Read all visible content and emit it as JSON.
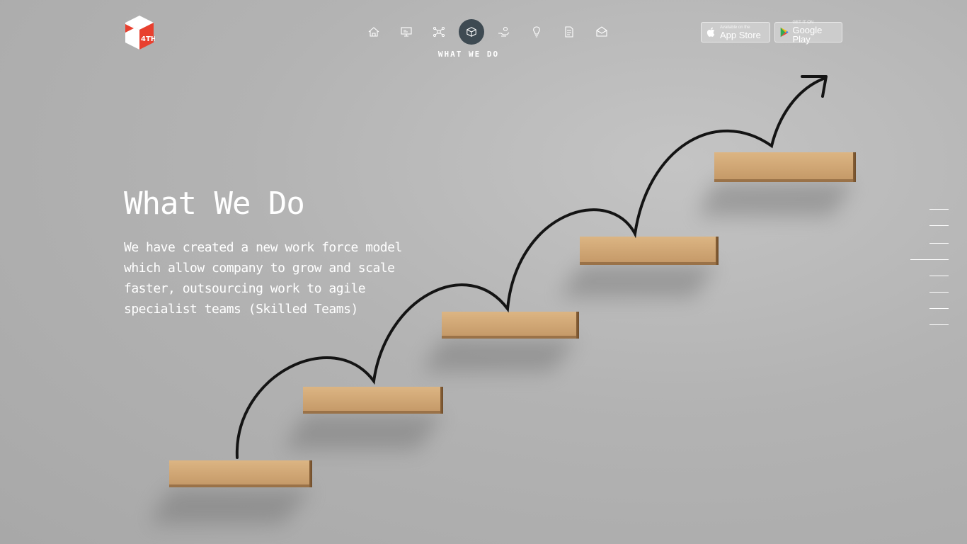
{
  "header": {
    "logo_text": "4TH",
    "nav": {
      "items": [
        {
          "icon": "home-icon"
        },
        {
          "icon": "monitor-icon"
        },
        {
          "icon": "network-icon"
        },
        {
          "icon": "cube-icon",
          "active": true
        },
        {
          "icon": "hand-coin-icon"
        },
        {
          "icon": "lightbulb-icon"
        },
        {
          "icon": "document-icon"
        },
        {
          "icon": "mail-icon"
        }
      ],
      "active_label": "WHAT WE DO"
    },
    "app_store": {
      "small": "Available on the",
      "big": "App Store"
    },
    "google_play": {
      "small": "GET IT ON",
      "big": "Google Play"
    }
  },
  "hero": {
    "title": "What We Do",
    "description": "We have created a new work force model which allow company to grow and scale faster, outsourcing work to agile specialist teams (Skilled Teams)"
  },
  "side_nav": {
    "count": 8,
    "active_index": 3
  },
  "colors": {
    "accent": "#3e4a52",
    "logo_red": "#e8402f",
    "wood": "#c8a070",
    "background": "#b3b3b3"
  }
}
